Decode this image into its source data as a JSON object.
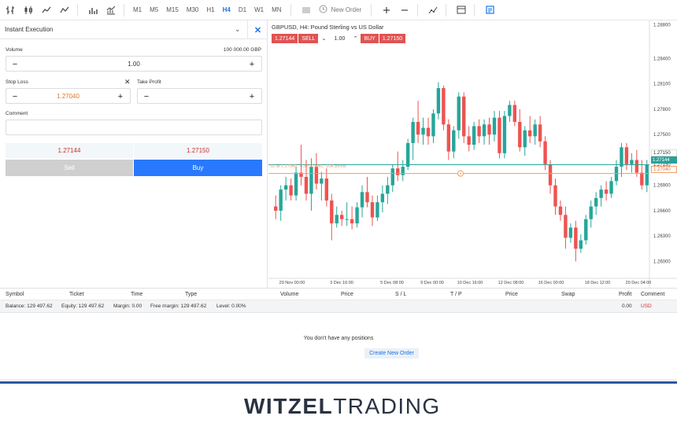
{
  "toolbar": {
    "timeframes": [
      "M1",
      "M5",
      "M15",
      "M30",
      "H1",
      "H4",
      "D1",
      "W1",
      "MN"
    ],
    "active_timeframe": "H4",
    "new_order_label": "New Order"
  },
  "order_panel": {
    "mode": "Instant Execution",
    "volume_label": "Volume",
    "volume_units": "100 000.00 GBP",
    "volume_value": "1.00",
    "stop_loss_label": "Stop Loss",
    "stop_loss_value": "1.27040",
    "take_profit_label": "Take Profit",
    "take_profit_value": "",
    "comment_label": "Comment",
    "comment_value": "",
    "bid_price": "1.27144",
    "ask_price": "1.27150",
    "sell_label": "Sell",
    "buy_label": "Buy"
  },
  "chart": {
    "title": "GBPUSD, H4: Pound Sterling vs US Dollar",
    "sell_price": "1.27144",
    "sell_label": "SELL",
    "volume": "1.00",
    "buy_label": "BUY",
    "buy_price": "1.27150",
    "sl_line_label": "SL at 1.27040, -110.00 (84), -104 points",
    "price_bid_box": "1.27144",
    "price_ask_box": "1.27150",
    "price_sl_box": "1.27040"
  },
  "chart_data": {
    "type": "candlestick",
    "title": "GBPUSD, H4: Pound Sterling vs US Dollar",
    "y_ticks": [
      "1.28800",
      "1.28400",
      "1.28100",
      "1.27800",
      "1.27500",
      "1.27150",
      "1.26900",
      "1.26600",
      "1.26300",
      "1.26000"
    ],
    "x_ticks": [
      "29 Nov 00:00",
      "3 Dec 16:00",
      "5 Dec 08:00",
      "9 Dec 00:00",
      "10 Dec 16:00",
      "12 Dec 08:00",
      "16 Dec 00:00",
      "18 Dec 12:00",
      "20 Dec 04:00"
    ],
    "ylim": [
      1.258,
      1.2885
    ],
    "up_color": "#26a69a",
    "down_color": "#ef5350",
    "lines": [
      {
        "name": "bid",
        "value": 1.27144,
        "color": "#26a69a"
      },
      {
        "name": "stop_loss",
        "value": 1.2704,
        "color": "#f39a5c"
      }
    ],
    "candles": [
      [
        1.2665,
        1.2678,
        1.265,
        1.266
      ],
      [
        1.266,
        1.269,
        1.2648,
        1.2685
      ],
      [
        1.2685,
        1.27,
        1.2672,
        1.269
      ],
      [
        1.269,
        1.2698,
        1.2672,
        1.2678
      ],
      [
        1.2678,
        1.2712,
        1.2672,
        1.2705
      ],
      [
        1.2705,
        1.2738,
        1.269,
        1.27
      ],
      [
        1.27,
        1.272,
        1.2672,
        1.268
      ],
      [
        1.268,
        1.2722,
        1.266,
        1.2712
      ],
      [
        1.2712,
        1.2728,
        1.2685,
        1.2692
      ],
      [
        1.2692,
        1.2706,
        1.2672,
        1.2698
      ],
      [
        1.2698,
        1.271,
        1.2665,
        1.2672
      ],
      [
        1.2672,
        1.268,
        1.2625,
        1.2645
      ],
      [
        1.2645,
        1.2665,
        1.264,
        1.2655
      ],
      [
        1.2655,
        1.266,
        1.2642,
        1.265
      ],
      [
        1.265,
        1.267,
        1.2642,
        1.265
      ],
      [
        1.265,
        1.2665,
        1.2638,
        1.2645
      ],
      [
        1.2645,
        1.267,
        1.264,
        1.2664
      ],
      [
        1.2664,
        1.269,
        1.2652,
        1.2682
      ],
      [
        1.2682,
        1.27,
        1.2664,
        1.267
      ],
      [
        1.267,
        1.2678,
        1.2642,
        1.2652
      ],
      [
        1.2652,
        1.2678,
        1.2648,
        1.267
      ],
      [
        1.267,
        1.269,
        1.2658,
        1.268
      ],
      [
        1.268,
        1.27,
        1.2668,
        1.269
      ],
      [
        1.269,
        1.2715,
        1.2682,
        1.271
      ],
      [
        1.271,
        1.273,
        1.2695,
        1.2702
      ],
      [
        1.2702,
        1.272,
        1.2695,
        1.2712
      ],
      [
        1.2712,
        1.2745,
        1.2708,
        1.274
      ],
      [
        1.274,
        1.277,
        1.272,
        1.2765
      ],
      [
        1.2765,
        1.279,
        1.274,
        1.275
      ],
      [
        1.275,
        1.277,
        1.2738,
        1.2758
      ],
      [
        1.2758,
        1.277,
        1.2738,
        1.2748
      ],
      [
        1.2748,
        1.278,
        1.274,
        1.2775
      ],
      [
        1.2775,
        1.2812,
        1.2768,
        1.2805
      ],
      [
        1.2805,
        1.2808,
        1.2755,
        1.2762
      ],
      [
        1.2762,
        1.2768,
        1.272,
        1.273
      ],
      [
        1.273,
        1.276,
        1.2722,
        1.2755
      ],
      [
        1.2755,
        1.28,
        1.2745,
        1.2795
      ],
      [
        1.2795,
        1.28,
        1.274,
        1.2748
      ],
      [
        1.2748,
        1.276,
        1.273,
        1.2738
      ],
      [
        1.2738,
        1.2765,
        1.2732,
        1.276
      ],
      [
        1.276,
        1.2768,
        1.274,
        1.2748
      ],
      [
        1.2748,
        1.2768,
        1.2738,
        1.2762
      ],
      [
        1.2762,
        1.277,
        1.2738,
        1.275
      ],
      [
        1.275,
        1.2778,
        1.2742,
        1.277
      ],
      [
        1.277,
        1.2778,
        1.2722,
        1.2728
      ],
      [
        1.2728,
        1.2778,
        1.2722,
        1.2772
      ],
      [
        1.2772,
        1.279,
        1.2765,
        1.2785
      ],
      [
        1.2785,
        1.279,
        1.276,
        1.2765
      ],
      [
        1.2765,
        1.278,
        1.273,
        1.2735
      ],
      [
        1.2735,
        1.276,
        1.2725,
        1.2755
      ],
      [
        1.2755,
        1.2772,
        1.274,
        1.2748
      ],
      [
        1.2748,
        1.2768,
        1.2738,
        1.2762
      ],
      [
        1.2762,
        1.2772,
        1.2735,
        1.2742
      ],
      [
        1.2742,
        1.2748,
        1.2708,
        1.2715
      ],
      [
        1.2715,
        1.272,
        1.268,
        1.269
      ],
      [
        1.269,
        1.2698,
        1.2655,
        1.2665
      ],
      [
        1.2665,
        1.2672,
        1.2648,
        1.2655
      ],
      [
        1.2655,
        1.2665,
        1.2615,
        1.2628
      ],
      [
        1.2628,
        1.2645,
        1.2622,
        1.264
      ],
      [
        1.264,
        1.2648,
        1.26,
        1.2615
      ],
      [
        1.2615,
        1.2632,
        1.261,
        1.2625
      ],
      [
        1.2625,
        1.2655,
        1.262,
        1.265
      ],
      [
        1.265,
        1.2672,
        1.264,
        1.2665
      ],
      [
        1.2665,
        1.2682,
        1.2655,
        1.2675
      ],
      [
        1.2675,
        1.269,
        1.2665,
        1.2685
      ],
      [
        1.2685,
        1.2695,
        1.2672,
        1.268
      ],
      [
        1.268,
        1.27,
        1.2675,
        1.2695
      ],
      [
        1.2695,
        1.272,
        1.269,
        1.2712
      ],
      [
        1.2712,
        1.274,
        1.27,
        1.2735
      ],
      [
        1.2735,
        1.274,
        1.2708,
        1.2715
      ],
      [
        1.2715,
        1.2728,
        1.2705,
        1.272
      ],
      [
        1.272,
        1.2732,
        1.27,
        1.2705
      ],
      [
        1.2705,
        1.272,
        1.2685,
        1.269
      ],
      [
        1.269,
        1.272,
        1.2682,
        1.2714
      ]
    ]
  },
  "positions_table": {
    "columns": [
      "Symbol",
      "Ticket",
      "Time",
      "Type",
      "Volume",
      "Price",
      "S / L",
      "T / P",
      "Price",
      "Swap",
      "Profit",
      "Comment"
    ],
    "balance_label": "Balance: 129 497.62",
    "equity_label": "Equity: 129 497.62",
    "margin_label": "Margin: 0.00",
    "free_margin_label": "Free margin: 129 497.62",
    "level_label": "Level: 0.00%",
    "profit_total": "0.00",
    "currency": "USD",
    "empty_message": "You don't have any positions",
    "create_order_label": "Create New Order"
  },
  "brand": {
    "part1": "WITZEL",
    "part2": "TRADING"
  }
}
